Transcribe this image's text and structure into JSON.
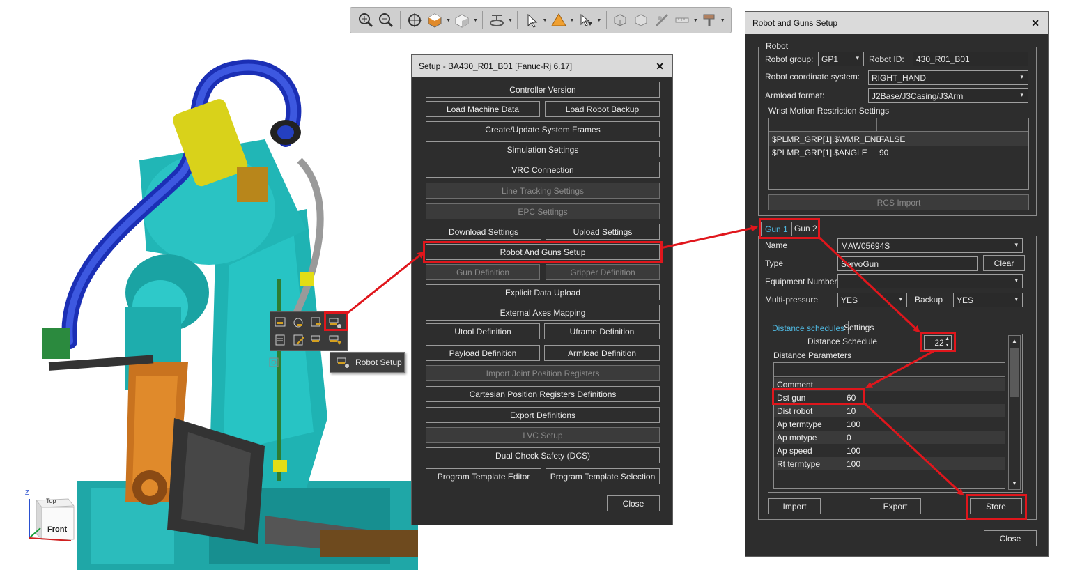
{
  "scene": {
    "orientation_cube": {
      "top": "Top",
      "front": "Front"
    },
    "axis_label": "Z"
  },
  "toolbar": {
    "icons": [
      "zoom-in-icon",
      "zoom-out-icon",
      "target-icon",
      "shading-cube-icon",
      "solid-cube-icon",
      "visibility-icon",
      "select-arrow-icon",
      "cone-icon",
      "pointer-select-icon",
      "box-select-icon",
      "frame-icon",
      "weld-icon",
      "ruler-icon",
      "paint-roller-icon"
    ]
  },
  "context_popup": {
    "tooltip": "Robot Setup"
  },
  "setup": {
    "title": "Setup - BA430_R01_B01  [Fanuc-Rj 6.17]",
    "buttons": [
      {
        "label": "Controller Version",
        "enabled": true
      },
      {
        "label": "Load Machine Data",
        "enabled": true
      },
      {
        "label": "Load Robot Backup",
        "enabled": true
      },
      {
        "label": "Create/Update System Frames",
        "enabled": true
      },
      {
        "label": "Simulation Settings",
        "enabled": true
      },
      {
        "label": "VRC Connection",
        "enabled": true
      },
      {
        "label": "Line Tracking Settings",
        "enabled": false
      },
      {
        "label": "EPC Settings",
        "enabled": false
      },
      {
        "label": "Download Settings",
        "enabled": true
      },
      {
        "label": "Upload Settings",
        "enabled": true
      },
      {
        "label": "Robot And Guns Setup",
        "enabled": true
      },
      {
        "label": "Gun Definition",
        "enabled": false
      },
      {
        "label": "Gripper Definition",
        "enabled": false
      },
      {
        "label": "Explicit Data Upload",
        "enabled": true
      },
      {
        "label": "External Axes Mapping",
        "enabled": true
      },
      {
        "label": "Utool Definition",
        "enabled": true
      },
      {
        "label": "Uframe Definition",
        "enabled": true
      },
      {
        "label": "Payload Definition",
        "enabled": true
      },
      {
        "label": "Armload Definition",
        "enabled": true
      },
      {
        "label": "Import Joint Position Registers",
        "enabled": false
      },
      {
        "label": "Cartesian Position Registers Definitions",
        "enabled": true
      },
      {
        "label": "Export Definitions",
        "enabled": true
      },
      {
        "label": "LVC Setup",
        "enabled": false
      },
      {
        "label": "Dual Check Safety (DCS)",
        "enabled": true
      },
      {
        "label": "Program Template Editor",
        "enabled": true
      },
      {
        "label": "Program Template Selection",
        "enabled": true
      }
    ],
    "close_label": "Close"
  },
  "robot_guns": {
    "title": "Robot and Guns Setup",
    "robot_group_label": "Robot",
    "robot_group": {
      "label": "Robot group:",
      "value": "GP1"
    },
    "robot_id": {
      "label": "Robot ID:",
      "value": "430_R01_B01"
    },
    "coord_system": {
      "label": "Robot coordinate system:",
      "value": "RIGHT_HAND"
    },
    "armload_format": {
      "label": "Armload format:",
      "value": "J2Base/J3Casing/J3Arm"
    },
    "wrist_label": "Wrist Motion Restriction Settings",
    "wrist_rows": [
      {
        "key": "$PLMR_GRP[1].$WMR_ENB",
        "value": "FALSE"
      },
      {
        "key": "$PLMR_GRP[1].$ANGLE",
        "value": "90"
      }
    ],
    "rcs_import": "RCS Import",
    "gun_tabs": [
      "Gun 1",
      "Gun 2"
    ],
    "name": {
      "label": "Name",
      "value": "MAW05694S"
    },
    "type": {
      "label": "Type",
      "value": "ServoGun"
    },
    "clear_label": "Clear",
    "equipment": {
      "label": "Equipment Number",
      "value": ""
    },
    "multi_pressure": {
      "label": "Multi-pressure",
      "value": "YES"
    },
    "backup": {
      "label": "Backup",
      "value": "YES"
    },
    "sub_tabs": [
      "Distance schedules",
      "Settings"
    ],
    "distance_schedule": {
      "label": "Distance Schedule",
      "value": "22"
    },
    "distance_params_label": "Distance Parameters",
    "params": [
      {
        "key": "Comment",
        "value": ""
      },
      {
        "key": "Dst gun",
        "value": "60"
      },
      {
        "key": "Dist robot",
        "value": "10"
      },
      {
        "key": "Ap termtype",
        "value": "100"
      },
      {
        "key": "Ap motype",
        "value": "0"
      },
      {
        "key": "Ap speed",
        "value": "100"
      },
      {
        "key": "Rt termtype",
        "value": "100"
      }
    ],
    "import_label": "Import",
    "export_label": "Export",
    "store_label": "Store",
    "close_label": "Close"
  },
  "colors": {
    "highlight": "#e0161c",
    "dialog_bg": "#2d2d2d",
    "tab_active": "#4fb8e0"
  }
}
